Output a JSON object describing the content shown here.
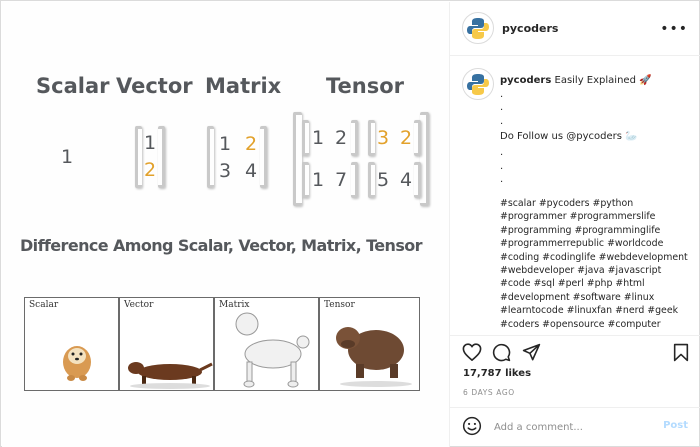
{
  "post_image": {
    "headers": [
      "Scalar",
      "Vector",
      "Matrix",
      "Tensor"
    ],
    "scalar_value": "1",
    "vector_values": [
      "1",
      "2"
    ],
    "matrix_values": [
      [
        "1",
        "2"
      ],
      [
        "3",
        "4"
      ]
    ],
    "tensor_values": [
      [
        [
          "1",
          "2"
        ],
        [
          "1",
          "7"
        ]
      ],
      [
        [
          "3",
          "2"
        ],
        [
          "5",
          "4"
        ]
      ]
    ],
    "subtitle": "Difference Among Scalar, Vector, Matrix, Tensor",
    "panels": [
      "Scalar",
      "Vector",
      "Matrix",
      "Tensor"
    ]
  },
  "header": {
    "username": "pycoders"
  },
  "caption": {
    "username": "pycoders",
    "title": "Easily Explained 🚀",
    "dots_top": [
      ".",
      ".",
      "."
    ],
    "follow": "Do Follow us @pycoders 🦢",
    "dots_bottom": [
      ".",
      ".",
      "."
    ],
    "hashtags": [
      "#scalar #pycoders #python",
      "#programmer #programmerslife",
      "#programming #programminglife",
      "#programmerrepublic #worldcode",
      "#coding #codinglife #webdevelopment",
      "#webdeveloper #java #javascript",
      "#code #sql #perl #php #html",
      "#development #software #linux",
      "#learntocode #linuxfan #nerd #geek",
      "#coders #opensource #computer"
    ]
  },
  "actions": {
    "likes": "17,787 likes",
    "time_ago": "6 DAYS AGO",
    "comment_placeholder": "Add a comment...",
    "post_label": "Post"
  },
  "icons": [
    "ellipsis-icon",
    "heart-icon",
    "comment-icon",
    "share-icon",
    "bookmark-icon",
    "emoji-icon"
  ],
  "colors": {
    "accent_orange": "#e2a12b",
    "text_gray": "#55585c",
    "muted": "#8e8e8e",
    "post_disabled": "#b3dbff"
  }
}
